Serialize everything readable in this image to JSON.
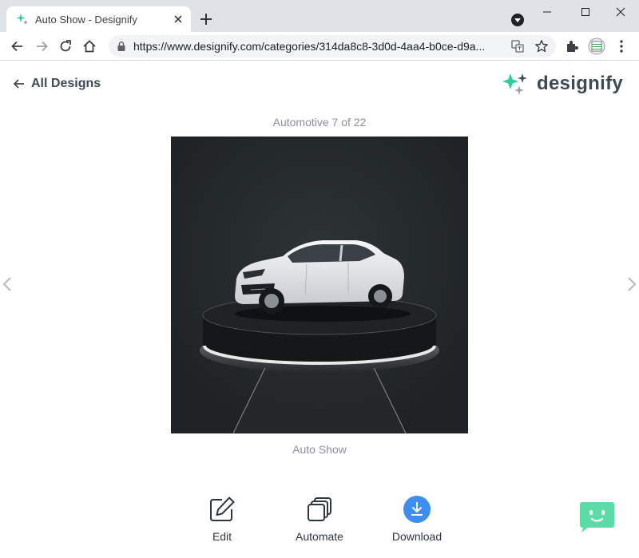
{
  "browser": {
    "tab_title": "Auto Show - Designify",
    "url": "https://www.designify.com/categories/314da8c8-3d0d-4aa4-b0ce-d9a..."
  },
  "page": {
    "back_label": "All Designs",
    "logo_text": "designify",
    "counter": "Automotive 7 of 22",
    "design_title": "Auto Show",
    "actions": {
      "edit": "Edit",
      "automate": "Automate",
      "download": "Download"
    }
  },
  "colors": {
    "brand_green": "#2ecc9b",
    "download_blue": "#3d8ef0",
    "image_bg": "#25292b",
    "chat_green": "#5ddba6"
  },
  "icons": [
    "favicon-sparkle-icon",
    "close-icon",
    "plus-icon",
    "back-icon",
    "forward-icon",
    "reload-icon",
    "home-icon",
    "lock-icon",
    "translate-icon",
    "star-icon",
    "extensions-icon",
    "menu-icon",
    "arrow-left-icon",
    "edit-icon",
    "automate-icon",
    "download-icon",
    "chat-bot-icon"
  ]
}
